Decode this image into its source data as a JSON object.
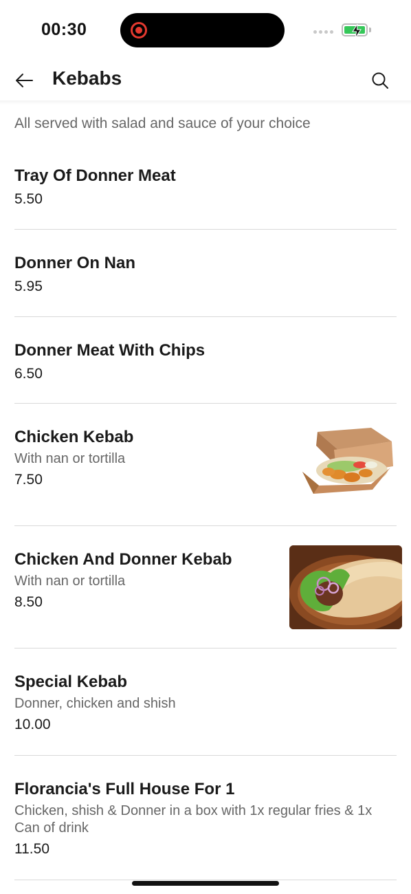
{
  "status_bar": {
    "time": "00:30",
    "battery_color": "#35c759",
    "recording_color": "#e5392f"
  },
  "header": {
    "title": "Kebabs",
    "back_icon": "arrow-left-icon",
    "search_icon": "search-icon"
  },
  "category": {
    "description": "All served with salad and sauce of your choice"
  },
  "items": [
    {
      "name": "Tray Of Donner Meat",
      "price": "5.50"
    },
    {
      "name": "Donner On Nan",
      "price": "5.95"
    },
    {
      "name": "Donner Meat With Chips",
      "price": "6.50"
    },
    {
      "name": "Chicken Kebab",
      "description": "With nan or tortilla",
      "price": "7.50",
      "image": "chicken-kebab-box-photo"
    },
    {
      "name": "Chicken And Donner Kebab",
      "description": "With nan or tortilla",
      "price": "8.50",
      "image": "wrap-photo"
    },
    {
      "name": "Special Kebab",
      "description": "Donner, chicken and shish",
      "price": "10.00"
    },
    {
      "name": "Florancia's Full House For 1",
      "description": "Chicken, shish & Donner in a box with 1x regular fries & 1x Can of drink",
      "price": "11.50"
    }
  ]
}
